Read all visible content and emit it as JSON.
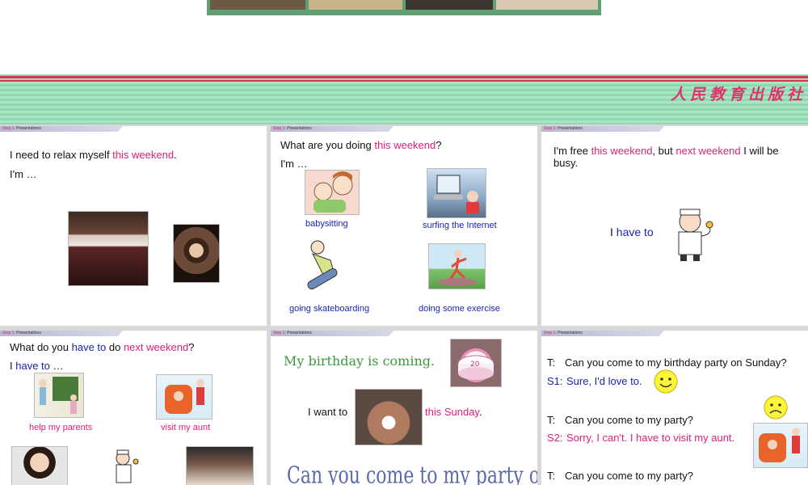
{
  "banner": {
    "publisher": "人民教育出版社"
  },
  "step_label": "Step 1:",
  "step_name": "Presentations",
  "slide1": {
    "line1_a": "I need to relax myself ",
    "line1_b": "this weekend",
    "line1_c": ".",
    "line2": "I'm …"
  },
  "slide2": {
    "line1_a": "What are you doing ",
    "line1_b": "this weekend",
    "line1_c": "?",
    "line2": "I'm …",
    "captions": [
      "babysitting",
      "surfing the Internet",
      "going skateboarding",
      "doing some exercise"
    ]
  },
  "slide3": {
    "line1_a": "I'm free ",
    "line1_b": "this weekend",
    "line1_c": ", but ",
    "line1_d": "next weekend",
    "line1_e": " I will be",
    "line1_f": "busy.",
    "have_a": "I ",
    "have_b": "have to"
  },
  "slide4": {
    "line1_a": "What do you ",
    "line1_b": "have to",
    "line1_c": " do ",
    "line1_d": "next weekend",
    "line1_e": "?",
    "line2_a": "I ",
    "line2_b": "have to",
    "line2_c": " …",
    "captions": [
      "help my parents",
      "visit my aunt"
    ]
  },
  "slide5": {
    "birthday": "My birthday is coming.",
    "want_a": "I want to ",
    "want_b": "this Sunday",
    "want_c": ".",
    "question": "Can you come to my party on Sunday?"
  },
  "slide6": {
    "t1_label": "T:",
    "t1": "Can you come to my  birthday party on Sunday?",
    "s1_label": "S1:",
    "s1": "Sure, I'd love to.",
    "t2_label": "T:",
    "t2": "Can you come to my party?",
    "s2_label": "S2:",
    "s2": "Sorry, I can't. I have to visit my aunt.",
    "t3_label": "T:",
    "t3": "Can you come to my party?"
  }
}
